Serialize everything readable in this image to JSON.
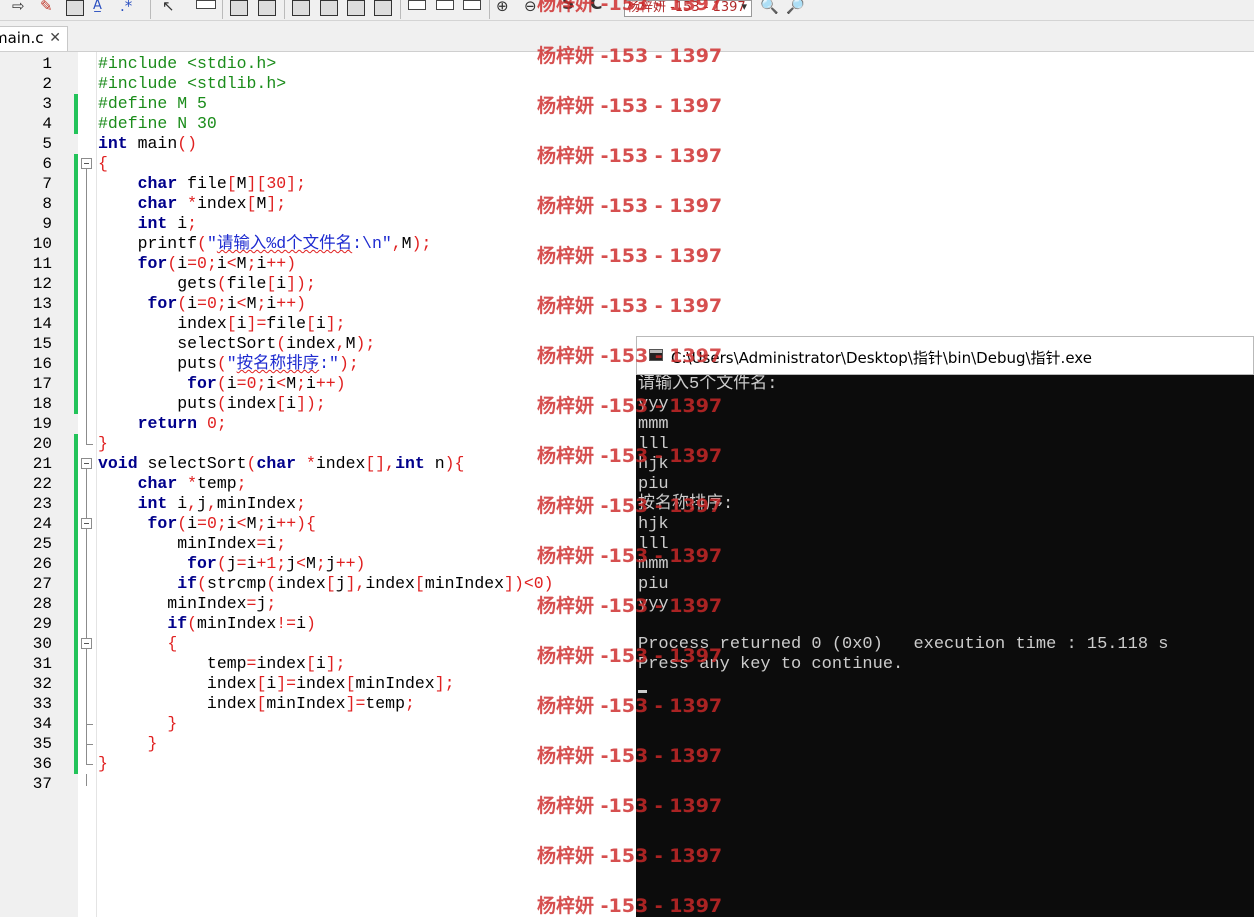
{
  "toolbar": {
    "search_value": "杨梓妍 -153 - 1397"
  },
  "tab": {
    "label": "main.c",
    "close": "✕"
  },
  "editor": {
    "line_numbers": [
      "1",
      "2",
      "3",
      "4",
      "5",
      "6",
      "7",
      "8",
      "9",
      "10",
      "11",
      "12",
      "13",
      "14",
      "15",
      "16",
      "17",
      "18",
      "19",
      "20",
      "21",
      "22",
      "23",
      "24",
      "25",
      "26",
      "27",
      "28",
      "29",
      "30",
      "31",
      "32",
      "33",
      "34",
      "35",
      "36",
      "37"
    ]
  },
  "watermark": {
    "text": "杨梓妍 -153 - 1397"
  },
  "console": {
    "title": "C:\\Users\\Administrator\\Desktop\\指针\\bin\\Debug\\指针.exe",
    "lines": [
      "请输入5个文件名:",
      "yyy",
      "mmm",
      "lll",
      "hjk",
      "piu",
      "按名称排序:",
      "hjk",
      "lll",
      "mmm",
      "piu",
      "yyy",
      "",
      "Process returned 0 (0x0)   execution time : 15.118 s",
      "Press any key to continue."
    ]
  }
}
